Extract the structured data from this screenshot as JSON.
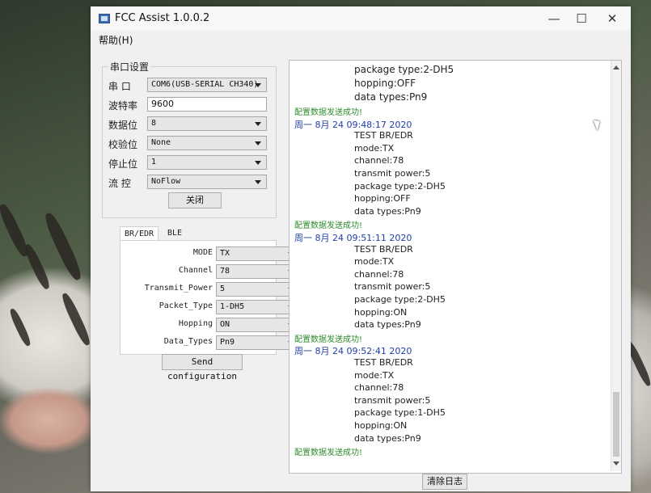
{
  "window": {
    "title": "FCC Assist 1.0.0.2",
    "minimize_glyph": "—",
    "maximize_glyph": "☐",
    "close_glyph": "✕"
  },
  "menu": {
    "help": "帮助(H)"
  },
  "serial": {
    "group_title": "串口设置",
    "port_label": "串  口",
    "port_value": "COM6(USB-SERIAL CH340)",
    "baud_label": "波特率",
    "baud_value": "9600",
    "databits_label": "数据位",
    "databits_value": "8",
    "parity_label": "校验位",
    "parity_value": "None",
    "stopbits_label": "停止位",
    "stopbits_value": "1",
    "flow_label": "流  控",
    "flow_value": "NoFlow",
    "close_button": "关闭"
  },
  "tabs": {
    "bredr": "BR/EDR",
    "ble": "BLE"
  },
  "config": {
    "mode_label": "MODE",
    "mode_value": "TX",
    "channel_label": "Channel",
    "channel_value": "78",
    "power_label": "Transmit_Power",
    "power_value": "5",
    "packet_label": "Packet_Type",
    "packet_value": "1-DH5",
    "hopping_label": "Hopping",
    "hopping_value": "ON",
    "datatypes_label": "Data_Types",
    "datatypes_value": "Pn9",
    "send_button": "Send configuration"
  },
  "log": {
    "lines": [
      {
        "kind": "field",
        "big": true,
        "text": "package type:2-DH5"
      },
      {
        "kind": "field",
        "big": true,
        "text": "hopping:OFF"
      },
      {
        "kind": "field",
        "big": true,
        "text": "data types:Pn9"
      },
      {
        "kind": "ok",
        "text": "配置数据发送成功!"
      },
      {
        "kind": "ts",
        "text": "周一 8月 24 09:48:17 2020"
      },
      {
        "kind": "field",
        "text": "TEST BR/EDR"
      },
      {
        "kind": "field",
        "text": "mode:TX"
      },
      {
        "kind": "field",
        "text": "channel:78"
      },
      {
        "kind": "field",
        "text": "transmit power:5"
      },
      {
        "kind": "field",
        "text": "package type:2-DH5"
      },
      {
        "kind": "field",
        "text": "hopping:OFF"
      },
      {
        "kind": "field",
        "text": "data types:Pn9"
      },
      {
        "kind": "ok",
        "text": "配置数据发送成功!"
      },
      {
        "kind": "ts",
        "text": "周一 8月 24 09:51:11 2020"
      },
      {
        "kind": "field",
        "text": "TEST BR/EDR"
      },
      {
        "kind": "field",
        "text": "mode:TX"
      },
      {
        "kind": "field",
        "text": "channel:78"
      },
      {
        "kind": "field",
        "text": "transmit power:5"
      },
      {
        "kind": "field",
        "text": "package type:2-DH5"
      },
      {
        "kind": "field",
        "text": "hopping:ON"
      },
      {
        "kind": "field",
        "text": "data types:Pn9"
      },
      {
        "kind": "ok",
        "text": "配置数据发送成功!"
      },
      {
        "kind": "ts",
        "text": "周一 8月 24 09:52:41 2020"
      },
      {
        "kind": "field",
        "text": "TEST BR/EDR"
      },
      {
        "kind": "field",
        "text": "mode:TX"
      },
      {
        "kind": "field",
        "text": "channel:78"
      },
      {
        "kind": "field",
        "text": "transmit power:5"
      },
      {
        "kind": "field",
        "text": "package type:1-DH5"
      },
      {
        "kind": "field",
        "text": "hopping:ON"
      },
      {
        "kind": "field",
        "text": "data types:Pn9"
      },
      {
        "kind": "ok",
        "text": "配置数据发送成功!"
      }
    ],
    "clear_button": "清除日志"
  }
}
